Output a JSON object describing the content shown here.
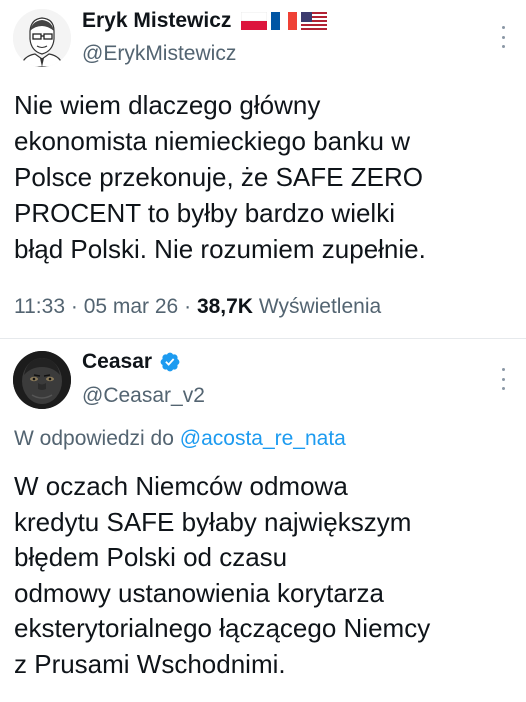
{
  "tweet1": {
    "author_name": "Eryk Mistewicz",
    "handle": "@ErykMistewicz",
    "flags": [
      "poland-flag",
      "france-flag",
      "usa-flag"
    ],
    "text": "Nie wiem dlaczego główny\nekonomista niemieckiego banku w\nPolsce przekonuje, że SAFE ZERO\nPROCENT to byłby bardzo wielki\nbłąd Polski. Nie rozumiem zupełnie.",
    "time": "11:33",
    "date": "05 mar 26",
    "views_count": "38,7K",
    "views_label": "Wyświetlenia",
    "separator": "·"
  },
  "tweet2": {
    "author_name": "Ceasar",
    "handle": "@Ceasar_v2",
    "reply_prefix": "W odpowiedzi do",
    "reply_handle": "@acosta_re_nata",
    "text": "W oczach Niemców odmowa\nkredytu SAFE byłaby największym\nbłędem Polski od czasu\nodmowy ustanowienia korytarza\neksterytorialnego łączącego Niemcy\nz Prusami Wschodnimi."
  },
  "colors": {
    "text_primary": "#0f1419",
    "text_secondary": "#536471",
    "link": "#1d9bf0",
    "divider": "#e6e9ec"
  },
  "icons": {
    "more": "more-vertical-icon",
    "verified": "verified-badge-icon"
  }
}
